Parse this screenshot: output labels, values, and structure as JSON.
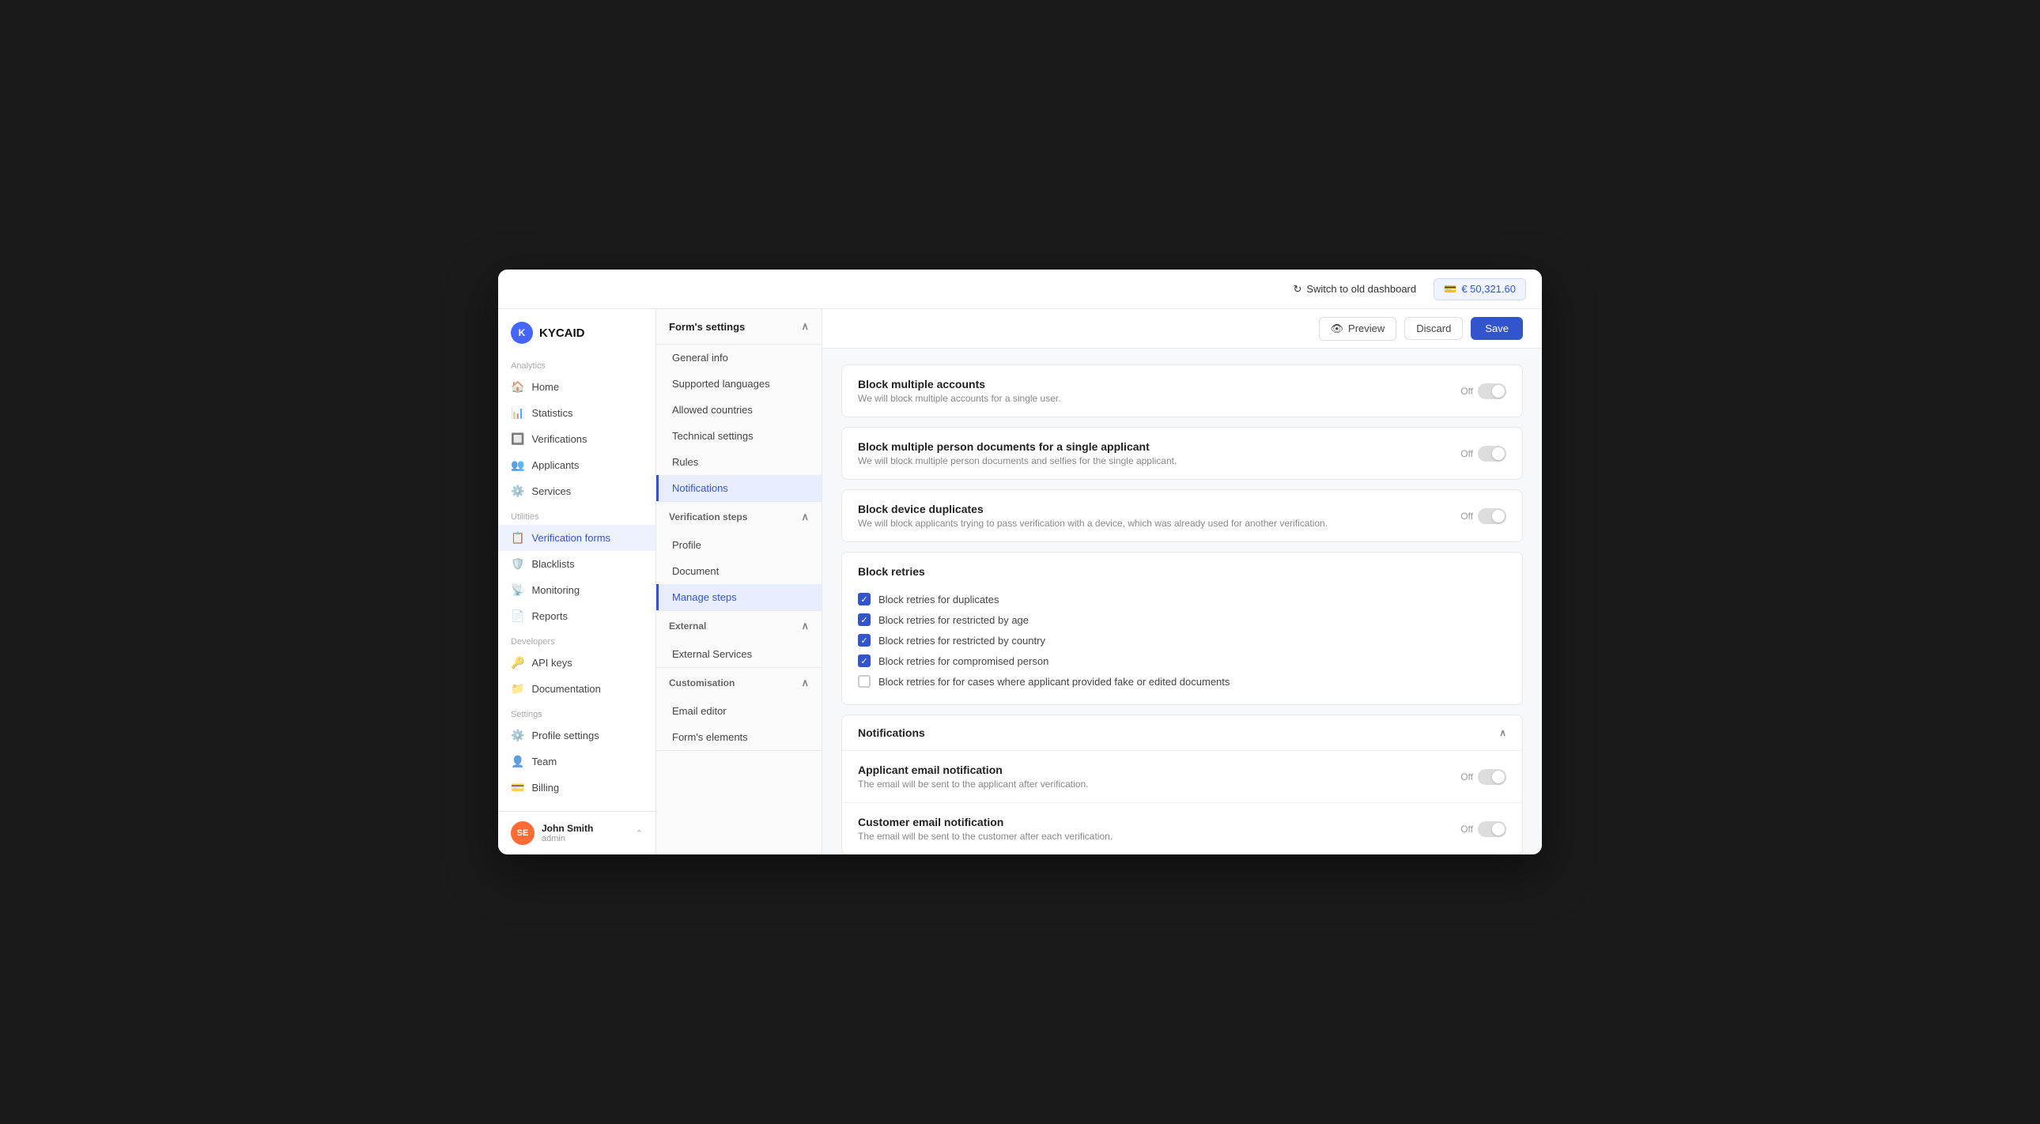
{
  "app": {
    "logo_text": "KYCAID",
    "switch_dashboard_label": "Switch to old dashboard",
    "balance": "€ 50,321.60"
  },
  "sidebar": {
    "analytics_label": "Analytics",
    "items_analytics": [
      {
        "label": "Home",
        "icon": "🏠",
        "active": false,
        "name": "home"
      },
      {
        "label": "Statistics",
        "icon": "📊",
        "active": false,
        "name": "statistics"
      },
      {
        "label": "Verifications",
        "icon": "🔲",
        "active": false,
        "name": "verifications"
      },
      {
        "label": "Applicants",
        "icon": "👥",
        "active": false,
        "name": "applicants"
      },
      {
        "label": "Services",
        "icon": "⚙️",
        "active": false,
        "name": "services"
      }
    ],
    "utilities_label": "Utilities",
    "items_utilities": [
      {
        "label": "Verification forms",
        "icon": "📋",
        "active": true,
        "name": "verification-forms"
      },
      {
        "label": "Blacklists",
        "icon": "🛡️",
        "active": false,
        "name": "blacklists"
      },
      {
        "label": "Monitoring",
        "icon": "📡",
        "active": false,
        "name": "monitoring"
      },
      {
        "label": "Reports",
        "icon": "📄",
        "active": false,
        "name": "reports"
      }
    ],
    "developers_label": "Developers",
    "items_developers": [
      {
        "label": "API keys",
        "icon": "🔑",
        "active": false,
        "name": "api-keys"
      },
      {
        "label": "Documentation",
        "icon": "📁",
        "active": false,
        "name": "documentation"
      }
    ],
    "settings_label": "Settings",
    "items_settings": [
      {
        "label": "Profile settings",
        "icon": "⚙️",
        "active": false,
        "name": "profile-settings"
      },
      {
        "label": "Team",
        "icon": "👤",
        "active": false,
        "name": "team"
      },
      {
        "label": "Billing",
        "icon": "💳",
        "active": false,
        "name": "billing"
      }
    ],
    "user": {
      "name": "John Smith",
      "role": "admin",
      "initials": "SE"
    }
  },
  "middle_nav": {
    "form_settings_label": "Form's settings",
    "items_form_settings": [
      {
        "label": "General info",
        "active": false
      },
      {
        "label": "Supported languages",
        "active": false
      },
      {
        "label": "Allowed countries",
        "active": false
      },
      {
        "label": "Technical settings",
        "active": false
      },
      {
        "label": "Rules",
        "active": false
      },
      {
        "label": "Notifications",
        "active": true
      }
    ],
    "verification_steps_label": "Verification steps",
    "items_verification_steps": [
      {
        "label": "Profile",
        "active": false
      },
      {
        "label": "Document",
        "active": false
      },
      {
        "label": "Manage steps",
        "active": false
      }
    ],
    "external_label": "External",
    "items_external": [
      {
        "label": "External Services",
        "active": false
      }
    ],
    "customisation_label": "Customisation",
    "items_customisation": [
      {
        "label": "Email editor",
        "active": false
      },
      {
        "label": "Form's elements",
        "active": false
      }
    ]
  },
  "content_header": {
    "preview_label": "Preview",
    "discard_label": "Discard",
    "save_label": "Save"
  },
  "settings_cards": [
    {
      "title": "Block multiple accounts",
      "description": "We will block multiple accounts for a single user.",
      "toggle": "off"
    },
    {
      "title": "Block multiple person documents for a single applicant",
      "description": "We will block multiple person documents and selfies for the single applicant.",
      "toggle": "off"
    },
    {
      "title": "Block device duplicates",
      "description": "We will block applicants trying to pass verification with a device, which was already used for another verification.",
      "toggle": "off"
    }
  ],
  "block_retries": {
    "title": "Block retries",
    "checkboxes": [
      {
        "label": "Block retries for duplicates",
        "checked": true
      },
      {
        "label": "Block retries for restricted by age",
        "checked": true
      },
      {
        "label": "Block retries for restricted by country",
        "checked": true
      },
      {
        "label": "Block retries for compromised person",
        "checked": true
      },
      {
        "label": "Block retries for for cases where applicant provided fake or edited documents",
        "checked": false
      }
    ]
  },
  "notifications": {
    "title": "Notifications",
    "items": [
      {
        "title": "Applicant email notification",
        "description": "The email will be sent to the applicant after verification.",
        "toggle": "off"
      },
      {
        "title": "Customer email notification",
        "description": "The email will be sent to the customer after each verification.",
        "toggle": "off"
      }
    ]
  }
}
